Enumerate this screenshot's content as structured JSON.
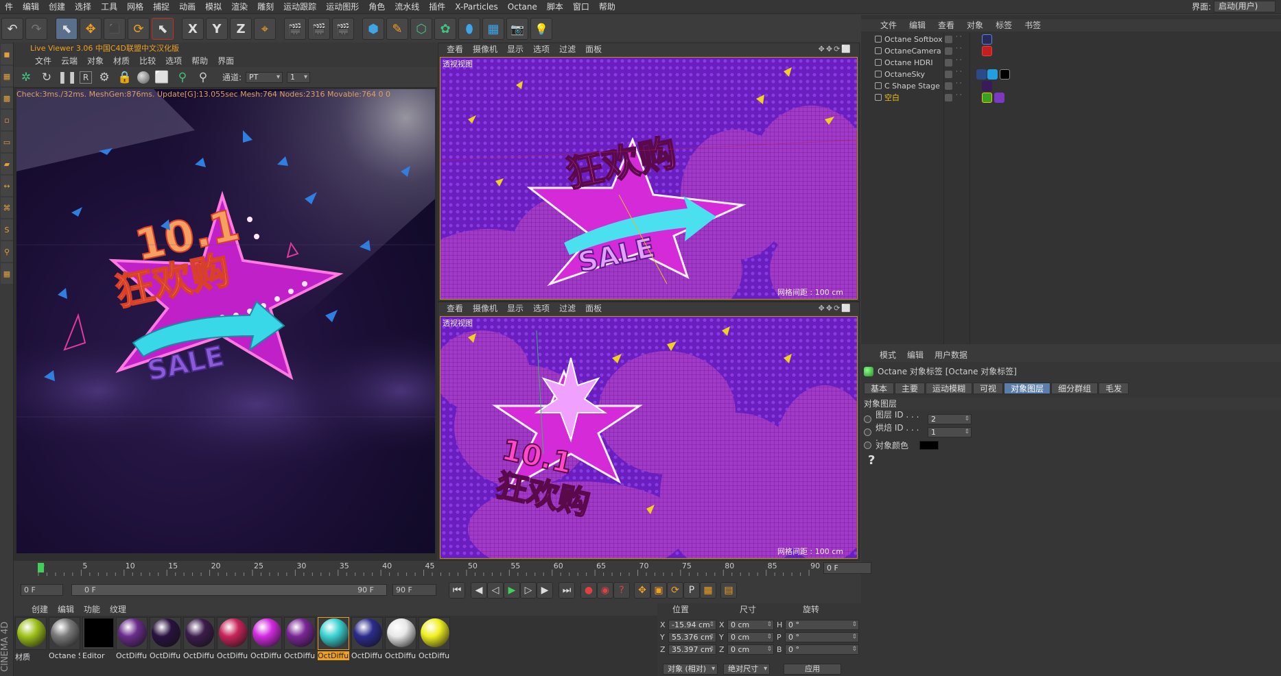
{
  "menubar": [
    "件",
    "编辑",
    "创建",
    "选择",
    "工具",
    "网格",
    "捕捉",
    "动画",
    "模拟",
    "渲染",
    "雕刻",
    "运动跟踪",
    "运动图形",
    "角色",
    "流水线",
    "插件",
    "X-Particles",
    "Octane",
    "脚本",
    "窗口",
    "帮助"
  ],
  "interface": {
    "label": "界面:",
    "value": "启动(用户)"
  },
  "toolbar": {
    "undo_icon": "↶",
    "redo_icon": "↷",
    "select_icon": "⬉",
    "move_icon": "✥",
    "scale_icon": "⬛",
    "rotate_icon": "⟳",
    "lastsel_icon": "⬉",
    "x": "X",
    "y": "Y",
    "z": "Z",
    "coord_icon": "⌖",
    "render1": "🎬",
    "render2": "🎬",
    "render3": "🎬",
    "cube": "⬢",
    "pen": "✎",
    "subdiv": "⬡",
    "cloner": "✿",
    "deform": "⬮",
    "floor": "▦",
    "camera": "📷",
    "light": "💡"
  },
  "live_viewer": {
    "title": "Live Viewer 3.06 中国C4D联盟中文汉化版",
    "menu": [
      "文件",
      "云端",
      "对象",
      "材质",
      "比较",
      "选项",
      "帮助",
      "界面"
    ],
    "channel_label": "通道:",
    "channel_value": "PT",
    "channel_num": "1",
    "status": "Check:3ms./32ms. MeshGen:876ms. Update[G]:13.055sec Mesh:764 Nodes:2316 Movable:764  0 0",
    "headline_line1": "10.1",
    "headline_line2": "狂欢购",
    "sale": "SALE"
  },
  "viewport_top": {
    "menu": [
      "查看",
      "摄像机",
      "显示",
      "选项",
      "过滤",
      "面板"
    ],
    "label": "透视视图",
    "grid": "网格间距 : 100 cm",
    "controls": "✥✥⟳⬜"
  },
  "viewport_bottom": {
    "menu": [
      "查看",
      "摄像机",
      "显示",
      "选项",
      "过滤",
      "面板"
    ],
    "label": "透视视图",
    "grid": "网格间距 : 100 cm",
    "controls": "✥✥⟳⬜"
  },
  "object_manager": {
    "menu": [
      "文件",
      "编辑",
      "查看",
      "对象",
      "标签",
      "书签"
    ],
    "objects": [
      {
        "name": "Octane Softbox"
      },
      {
        "name": "OctaneCamera"
      },
      {
        "name": "Octane HDRI"
      },
      {
        "name": "OctaneSky"
      },
      {
        "name": "C Shape Stage"
      },
      {
        "name": "空白"
      }
    ]
  },
  "attributes": {
    "menu": [
      "模式",
      "编辑",
      "用户数据"
    ],
    "title": "Octane 对象标签 [Octane 对象标签]",
    "tabs": [
      "基本",
      "主要",
      "运动模糊",
      "可视",
      "对象图层",
      "细分群组",
      "毛发"
    ],
    "section": "对象图层",
    "layer_id_label": "图层 ID . . . .",
    "layer_id_value": "2",
    "bake_id_label": "烘焙 ID . . . .",
    "bake_id_value": "1",
    "color_label": "对象颜色",
    "help": "?"
  },
  "timeline": {
    "ticks": [
      "0",
      "5",
      "10",
      "15",
      "20",
      "25",
      "30",
      "35",
      "40",
      "45",
      "50",
      "55",
      "60",
      "65",
      "70",
      "75",
      "80",
      "85",
      "90"
    ],
    "current": "0 F"
  },
  "playback": {
    "start": "0 F",
    "range_start": "0 F",
    "range_end": "90 F",
    "end": "90 F"
  },
  "materials": {
    "menu": [
      "创建",
      "编辑",
      "功能",
      "纹理"
    ],
    "items": [
      {
        "label": "材质",
        "color": "#9ec21a"
      },
      {
        "label": "Octane S",
        "color": "#7a7a7a"
      },
      {
        "label": "Editor",
        "color": "#000000"
      },
      {
        "label": "OctDiffu",
        "color": "#6a2c8c"
      },
      {
        "label": "OctDiffu",
        "color": "#2a1240"
      },
      {
        "label": "OctDiffu",
        "color": "#3c1c4c"
      },
      {
        "label": "OctDiffu",
        "color": "#c8245a"
      },
      {
        "label": "OctDiffu",
        "color": "#d22ae0"
      },
      {
        "label": "OctDiffu",
        "color": "#7a2696"
      },
      {
        "label": "OctDiffu",
        "color": "#3cd2d2"
      },
      {
        "label": "OctDiffu",
        "color": "#2c2c8c"
      },
      {
        "label": "OctDiffu",
        "color": "#e8e8e8"
      },
      {
        "label": "OctDiffu",
        "color": "#f0f020"
      }
    ]
  },
  "coords": {
    "head": [
      "位置",
      "尺寸",
      "旋转"
    ],
    "rows": [
      {
        "a": "X",
        "pos": "-15.94 cm",
        "b": "X",
        "size": "0 cm",
        "c": "H",
        "rot": "0 °"
      },
      {
        "a": "Y",
        "pos": "55.376 cm",
        "b": "Y",
        "size": "0 cm",
        "c": "P",
        "rot": "0 °"
      },
      {
        "a": "Z",
        "pos": "35.397 cm",
        "b": "Z",
        "size": "0 cm",
        "c": "B",
        "rot": "0 °"
      }
    ],
    "mode": "对象 (相对)",
    "size_mode": "绝对尺寸",
    "apply": "应用"
  },
  "cinema4d": "CINEMA 4D",
  "colors": {
    "accent_orange": "#f0a020",
    "selected_tab": "#5a7dab",
    "magenta": "#d830d8",
    "cyan": "#3cd8e8"
  }
}
